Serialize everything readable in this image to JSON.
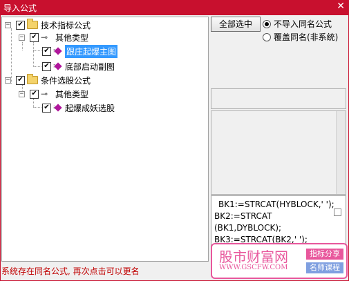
{
  "window": {
    "title": "导入公式",
    "close_glyph": "✕"
  },
  "tree": {
    "nodes": [
      {
        "label": "技术指标公式"
      },
      {
        "label": "其他类型"
      },
      {
        "label": "跟庄起爆主图"
      },
      {
        "label": "底部启动副图"
      },
      {
        "label": "条件选股公式"
      },
      {
        "label": "其他类型"
      },
      {
        "label": "起爆成妖选股"
      }
    ],
    "expander_glyph": "−",
    "check_glyph": "✔"
  },
  "options": {
    "select_all_label": "全部选中",
    "radio_no_import": "不导入同名公式",
    "radio_overwrite": "覆盖同名(非系统)"
  },
  "code_lines": [
    "BK1:=STRCAT(HYBLOCK,' ');",
    "BK2:=STRCAT",
    "(BK1,DYBLOCK);",
    "BK3:=STRCAT(BK2,' ');"
  ],
  "watermark": {
    "title": "股市财富网",
    "url": "WWW.GSCFW.COM",
    "tag1": "指标分享",
    "tag2": "名师课程"
  },
  "status_text": "系统存在同名公式, 再次点击可以更名",
  "colors": {
    "titlebar": "#c8102e",
    "selected": "#3399ff",
    "status": "#c00000",
    "watermark": "#e8579c"
  }
}
